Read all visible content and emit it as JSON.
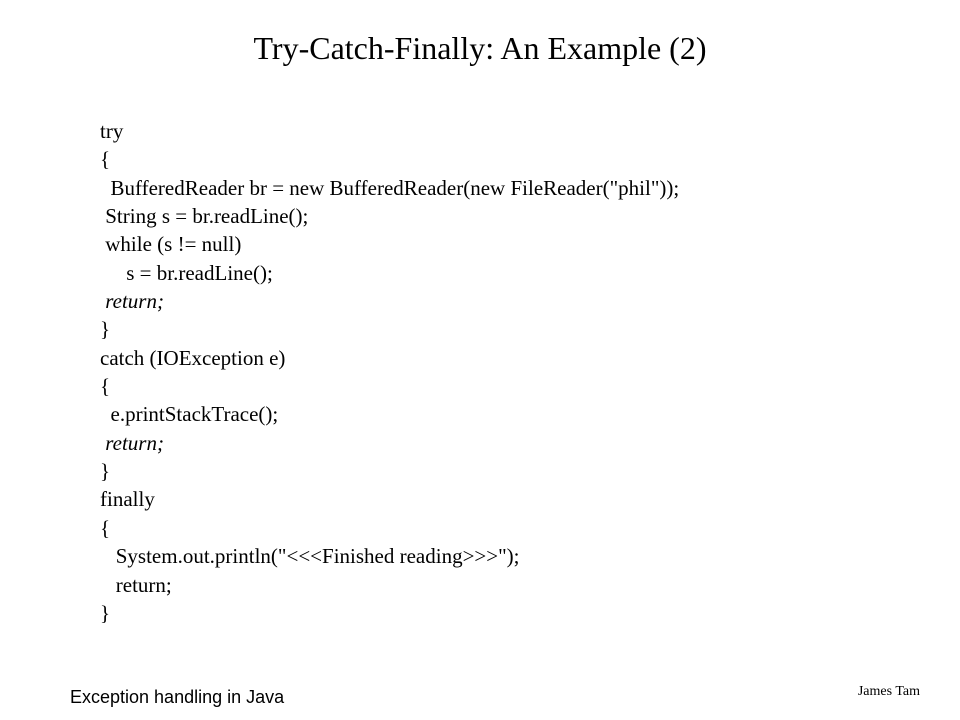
{
  "title": "Try-Catch-Finally: An Example (2)",
  "code": {
    "l1": "try",
    "l2": "{",
    "l3": "  BufferedReader br = new BufferedReader(new FileReader(\"phil\"));",
    "l4": " String s = br.readLine();",
    "l5": " while (s != null)",
    "l6": "     s = br.readLine();",
    "l7": " return;",
    "l8": "}",
    "l9": "catch (IOException e)",
    "l10": "{",
    "l11": "  e.printStackTrace();",
    "l12": " return;",
    "l13": "}",
    "l14": "finally",
    "l15": "{",
    "l16": "   System.out.println(\"<<<Finished reading>>>\");",
    "l17": "   return;",
    "l18": "}"
  },
  "footer_left": "Exception handling in Java",
  "footer_right": "James Tam"
}
